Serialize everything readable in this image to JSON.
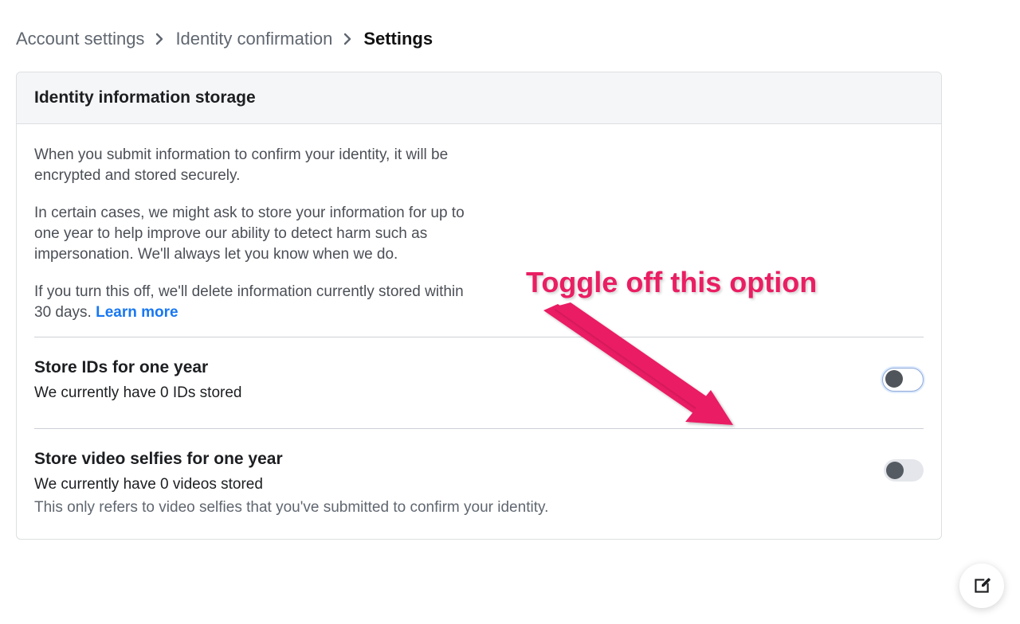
{
  "breadcrumb": {
    "items": [
      {
        "label": "Account settings"
      },
      {
        "label": "Identity confirmation"
      },
      {
        "label": "Settings"
      }
    ]
  },
  "card": {
    "title": "Identity information storage",
    "intro": {
      "p1": "When you submit information to confirm your identity, it will be encrypted and stored securely.",
      "p2": "In certain cases, we might ask to store your information for up to one year to help improve our ability to detect harm such as impersonation. We'll always let you know when we do.",
      "p3_prefix": "If you turn this off, we'll delete information currently stored within 30 days. ",
      "learn_more": "Learn more"
    },
    "settings": {
      "ids": {
        "title": "Store IDs for one year",
        "sub": "We currently have 0 IDs stored",
        "toggle_state": "off",
        "toggle_focused": true
      },
      "videos": {
        "title": "Store video selfies for one year",
        "sub": "We currently have 0 videos stored",
        "note": "This only refers to video selfies that you've submitted to confirm your identity.",
        "toggle_state": "off",
        "toggle_focused": false
      }
    }
  },
  "annotation": {
    "text": "Toggle off this option",
    "color": "#ea1e63"
  },
  "fab": {
    "label": "Edit"
  }
}
